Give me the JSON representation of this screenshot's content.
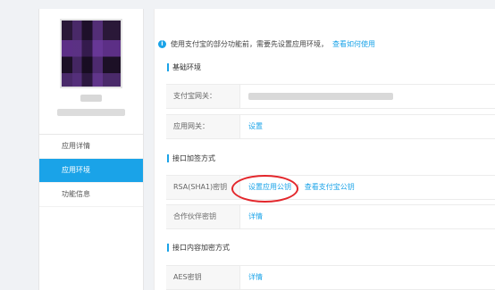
{
  "sidebar": {
    "items": [
      {
        "label": "应用详情",
        "active": false
      },
      {
        "label": "应用环境",
        "active": true
      },
      {
        "label": "功能信息",
        "active": false
      }
    ]
  },
  "notice": {
    "text": "使用支付宝的部分功能前，需要先设置应用环境，",
    "link": "查看如何使用"
  },
  "sections": {
    "env": {
      "title": "基础环境",
      "rows": {
        "gateway": {
          "label": "支付宝网关："
        },
        "app_gateway": {
          "label": "应用网关：",
          "value": "设置"
        }
      }
    },
    "sign": {
      "title": "接口加签方式",
      "rows": {
        "rsa": {
          "label": "RSA(SHA1)密钥",
          "link1": "设置应用公钥",
          "separator": "|",
          "link2": "查看支付宝公钥"
        },
        "partner": {
          "label": "合作伙伴密钥",
          "value": "详情"
        }
      }
    },
    "encrypt": {
      "title": "接口内容加密方式",
      "rows": {
        "aes": {
          "label": "AES密钥",
          "value": "详情"
        }
      }
    }
  },
  "colors": {
    "accent": "#1aa3e8",
    "highlight_circle": "#e3262b"
  }
}
